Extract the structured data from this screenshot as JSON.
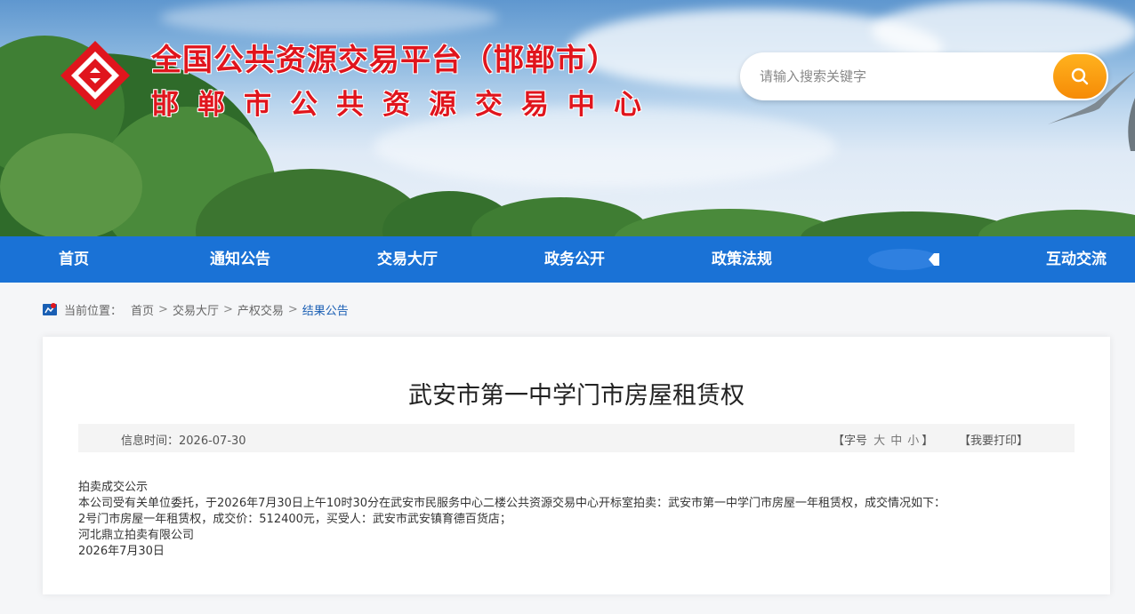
{
  "header": {
    "title_main": "全国公共资源交易平台（邯郸市）",
    "title_sub": "邯郸市公共资源交易中心",
    "logo_icon": "logo-diamond-icon",
    "brand_color": "#e0151d"
  },
  "search": {
    "placeholder": "请输入搜索关键字",
    "button_icon": "search-icon"
  },
  "nav": {
    "color": "#1a72d6",
    "items": [
      {
        "label": "首页"
      },
      {
        "label": "通知公告"
      },
      {
        "label": "交易大厅"
      },
      {
        "label": "政务公开"
      },
      {
        "label": "政策法规"
      },
      {
        "label": "互动交流"
      }
    ]
  },
  "breadcrumb": {
    "prefix": "当前位置：",
    "items": [
      "首页",
      "交易大厅",
      "产权交易",
      "结果公告"
    ],
    "separator": ">"
  },
  "article": {
    "title": "武安市第一中学门市房屋租赁权",
    "info_time": "信息时间：2026-07-30",
    "font_size_label": "字号",
    "font_large": "大",
    "font_medium": "中",
    "font_small": "小",
    "print_label": "我要打印",
    "body": [
      "拍卖成交公示",
      "本公司受有关单位委托，于2026年7月30日上午10时30分在武安市民服务中心二楼公共资源交易中心开标室拍卖：武安市第一中学门市房屋一年租赁权，成交情况如下：",
      "2号门市房屋一年租赁权，成交价：512400元，买受人：武安市武安镇育德百货店；",
      "河北鼎立拍卖有限公司",
      "2026年7月30日"
    ]
  }
}
